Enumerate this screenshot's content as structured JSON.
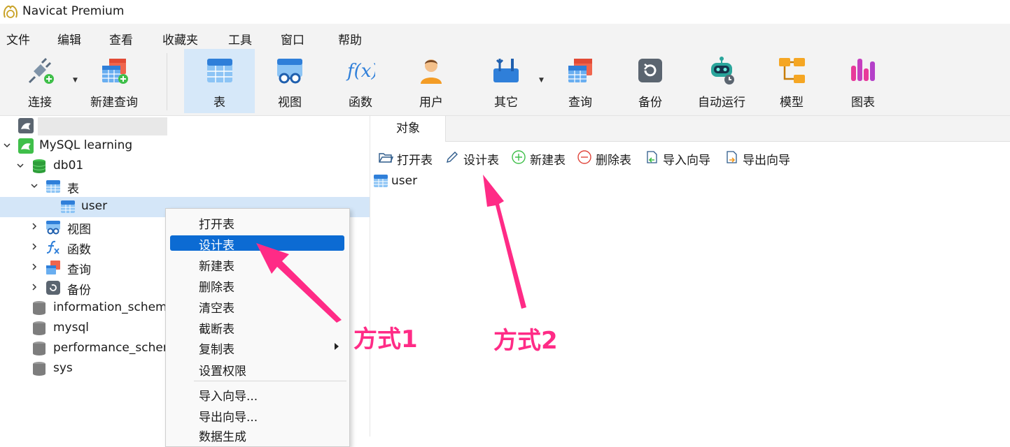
{
  "window": {
    "title": "Navicat Premium"
  },
  "menu": [
    "文件",
    "编辑",
    "查看",
    "收藏夹",
    "工具",
    "窗口",
    "帮助"
  ],
  "toolbar": {
    "connect": "连接",
    "new_query": "新建查询",
    "table": "表",
    "view": "视图",
    "function": "函数",
    "user": "用户",
    "other": "其它",
    "query": "查询",
    "backup": "备份",
    "automation": "自动运行",
    "model": "模型",
    "chart": "图表",
    "function_glyph": "f(x)"
  },
  "tree": {
    "connection": "MySQL learning",
    "database": "db01",
    "tables_group": "表",
    "table_item": "user",
    "views_group": "视图",
    "functions_group": "函数",
    "queries_group": "查询",
    "backups_group": "备份",
    "other_databases": [
      "information_schema",
      "mysql",
      "performance_schema",
      "sys"
    ]
  },
  "tabs": {
    "objects": "对象"
  },
  "object_toolbar": {
    "open_table": "打开表",
    "design_table": "设计表",
    "new_table": "新建表",
    "delete_table": "删除表",
    "import_wizard": "导入向导",
    "export_wizard": "导出向导"
  },
  "objects": [
    "user"
  ],
  "context_menu": {
    "items": [
      "打开表",
      "设计表",
      "新建表",
      "删除表",
      "清空表",
      "截断表",
      "复制表",
      "设置权限",
      "导入向导...",
      "导出向导...",
      "数据生成"
    ],
    "highlighted": "设计表"
  },
  "annotations": {
    "method1": "方式1",
    "method2": "方式2"
  },
  "colors": {
    "accent_blue": "#0c6bd3",
    "selection": "#d4e6f8",
    "annotation_pink": "#ff2b86",
    "mysql_green": "#3fbf4a"
  }
}
